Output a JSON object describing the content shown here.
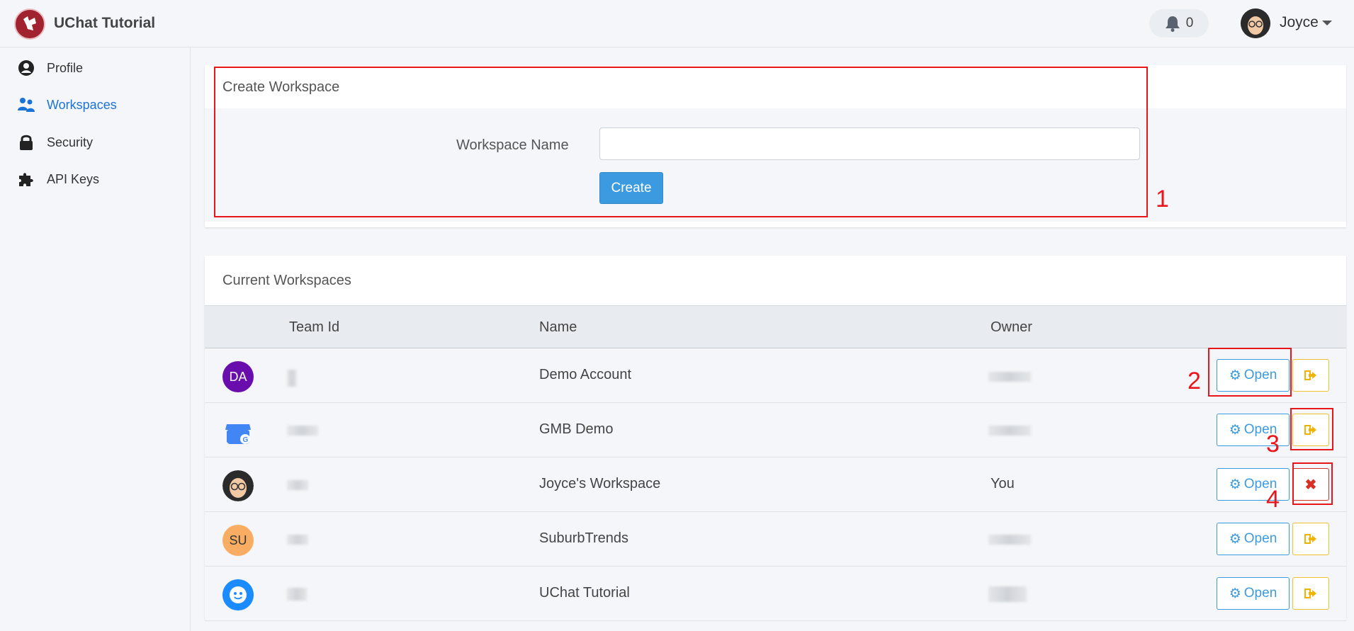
{
  "app": {
    "title": "UChat Tutorial"
  },
  "header": {
    "notification_count": "0",
    "user_name": "Joyce"
  },
  "sidebar": {
    "items": [
      {
        "label": "Profile",
        "icon": "user-circle-icon"
      },
      {
        "label": "Workspaces",
        "icon": "users-icon",
        "active": true
      },
      {
        "label": "Security",
        "icon": "lock-icon"
      },
      {
        "label": "API Keys",
        "icon": "puzzle-icon"
      }
    ]
  },
  "create_workspace": {
    "title": "Create Workspace",
    "field_label": "Workspace Name",
    "field_value": "",
    "button_label": "Create"
  },
  "current_workspaces": {
    "title": "Current Workspaces",
    "columns": {
      "team_id": "Team Id",
      "name": "Name",
      "owner": "Owner"
    },
    "rows": [
      {
        "avatar_text": "DA",
        "avatar_color": "#6a0dad",
        "name": "Demo Account",
        "owner": "",
        "action": "leave"
      },
      {
        "avatar_text": "",
        "avatar_color": "#4285f4",
        "name": "GMB Demo",
        "owner": "",
        "action": "leave"
      },
      {
        "avatar_text": "",
        "avatar_color": "#2b2b2b",
        "name": "Joyce's Workspace",
        "owner": "You",
        "action": "delete"
      },
      {
        "avatar_text": "SU",
        "avatar_color": "#f8ad62",
        "name": "SuburbTrends",
        "owner": "",
        "action": "leave"
      },
      {
        "avatar_text": "",
        "avatar_color": "#1a8cff",
        "name": "UChat Tutorial",
        "owner": "",
        "action": "leave"
      }
    ],
    "open_label": "Open"
  },
  "annotations": [
    "1",
    "2",
    "3",
    "4"
  ],
  "colors": {
    "accent": "#3c9be0",
    "active_nav": "#1a73d9",
    "annotation": "#e8161a",
    "leave": "#f0b400",
    "delete": "#d93025"
  }
}
